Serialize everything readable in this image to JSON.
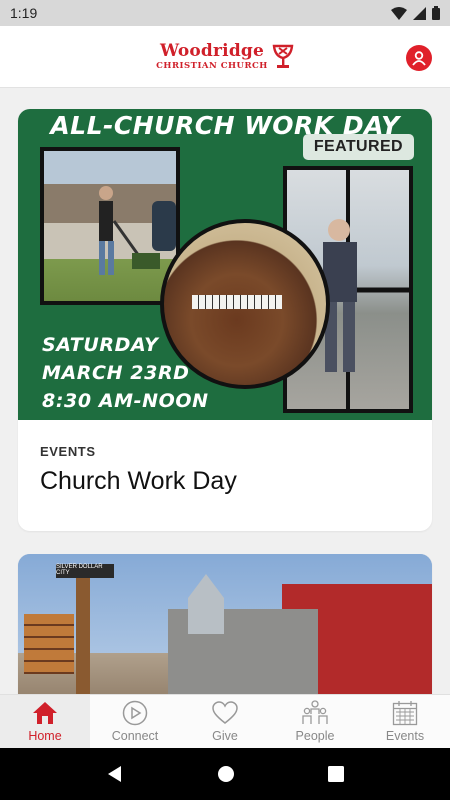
{
  "status_bar": {
    "time": "1:19"
  },
  "header": {
    "logo_name": "Woodridge",
    "logo_sub": "CHRISTIAN CHURCH",
    "brand_color": "#d0202a"
  },
  "feed": {
    "featured": {
      "hero_title": "ALL-CHURCH WORK DAY",
      "badge": "FEATURED",
      "hero_day": "SATURDAY",
      "hero_date": "MARCH 23RD",
      "hero_time": "8:30 AM-NOON",
      "category": "EVENTS",
      "title": "Church Work Day"
    },
    "second": {
      "sign_text": "SILVER DOLLAR CITY"
    }
  },
  "bottom_nav": {
    "items": [
      {
        "label": "Home",
        "icon": "home-icon",
        "active": true
      },
      {
        "label": "Connect",
        "icon": "play-circle-icon",
        "active": false
      },
      {
        "label": "Give",
        "icon": "heart-icon",
        "active": false
      },
      {
        "label": "People",
        "icon": "people-icon",
        "active": false
      },
      {
        "label": "Events",
        "icon": "calendar-icon",
        "active": false
      }
    ]
  }
}
